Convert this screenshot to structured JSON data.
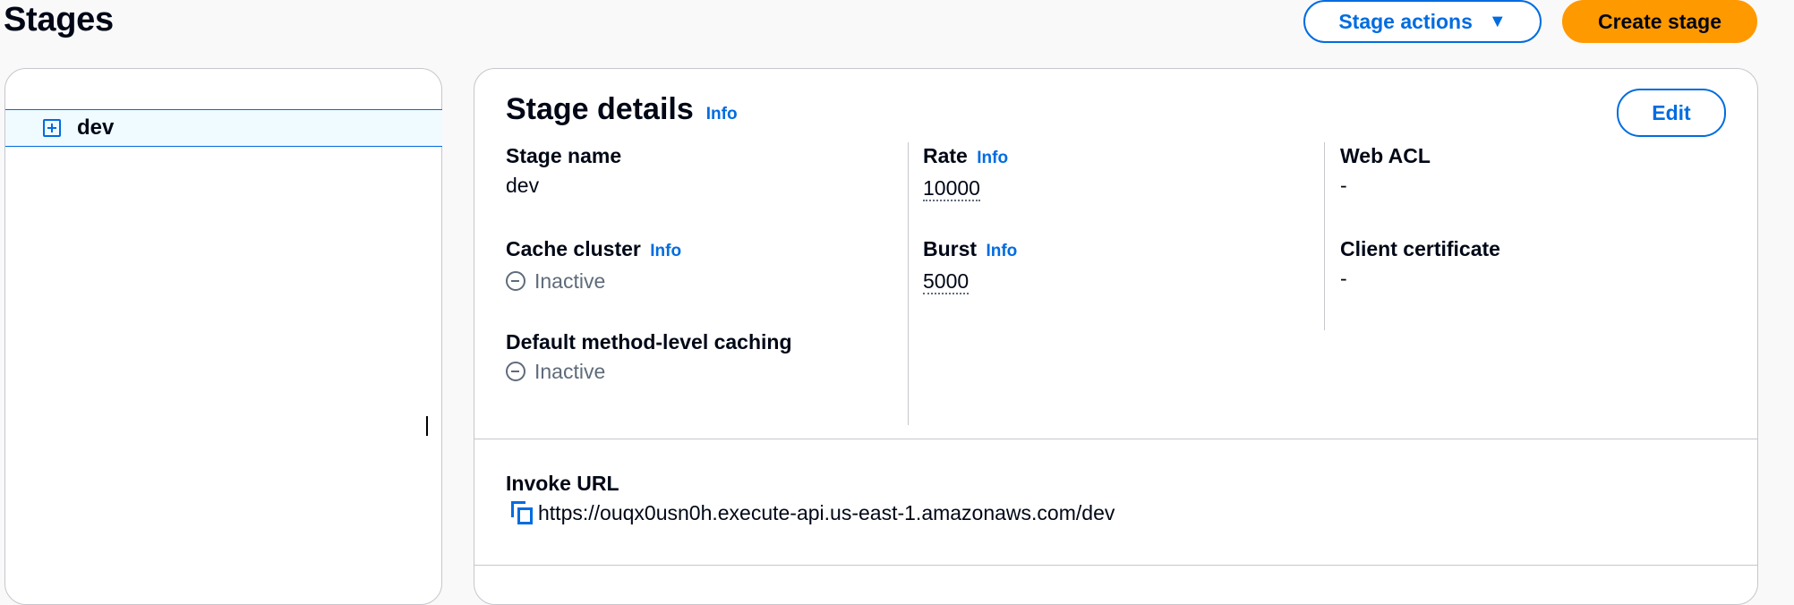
{
  "header": {
    "title": "Stages",
    "stage_actions_label": "Stage actions",
    "create_stage_label": "Create stage"
  },
  "tree": {
    "items": [
      {
        "label": "dev",
        "selected": true,
        "expand_icon": "plus-square-icon"
      }
    ]
  },
  "details": {
    "title": "Stage details",
    "info_label": "Info",
    "edit_label": "Edit",
    "stage_name": {
      "label": "Stage name",
      "value": "dev"
    },
    "cache_cluster": {
      "label": "Cache cluster",
      "info": "Info",
      "value": "Inactive",
      "icon": "status-stopped-icon"
    },
    "default_caching": {
      "label": "Default method-level caching",
      "value": "Inactive",
      "icon": "status-stopped-icon"
    },
    "rate": {
      "label": "Rate",
      "info": "Info",
      "value": "10000"
    },
    "burst": {
      "label": "Burst",
      "info": "Info",
      "value": "5000"
    },
    "web_acl": {
      "label": "Web ACL",
      "value": "-"
    },
    "client_certificate": {
      "label": "Client certificate",
      "value": "-"
    },
    "invoke_url": {
      "label": "Invoke URL",
      "value": "https://ouqx0usn0h.execute-api.us-east-1.amazonaws.com/dev",
      "icon": "copy-icon"
    }
  },
  "colors": {
    "accent": "#006ce0",
    "primary_button": "#ff9900",
    "selected_row_bg": "#f0fbff",
    "muted_text": "#5f6b7a",
    "divider": "#c6c6cd"
  }
}
